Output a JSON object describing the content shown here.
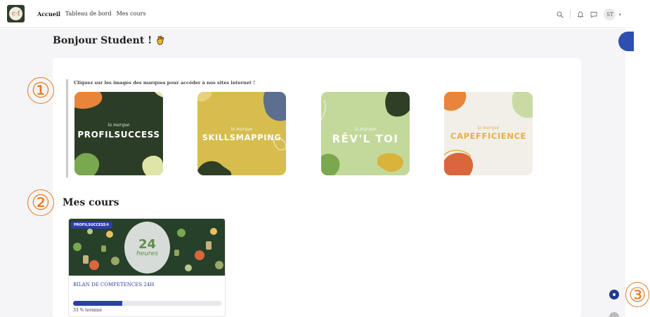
{
  "nav": {
    "logo_text": "c·f",
    "links": [
      "Accueil",
      "Tableau de bord",
      "Mes cours"
    ],
    "avatar_initials": "ST"
  },
  "greeting": "Bonjour Student !",
  "brands": {
    "intro": "Cliquez sur les images des marques pour accéder à nos sites internet !",
    "tiles": [
      {
        "small": "la marque",
        "name": "PROFILSUCCESS",
        "bg": "#2c3d27"
      },
      {
        "small": "la marque",
        "name": "SKILLSMAPPING",
        "bg": "#d6bd4e"
      },
      {
        "small": "la marque",
        "name": "RÊV'L TOI",
        "bg": "#c3d99b"
      },
      {
        "small": "la marque",
        "name": "CAPEFFICIENCE",
        "bg": "#f2efe8"
      }
    ]
  },
  "courses": {
    "title": "Mes cours",
    "items": [
      {
        "badge": "PROFILSUCCESS®",
        "hero_number": "24",
        "hero_unit": "heures",
        "name": "BILAN DE COMPETENCES 24H",
        "progress": 33,
        "progress_text": "33 % terminé"
      }
    ]
  },
  "markers": [
    "①",
    "②",
    "③"
  ],
  "colors": {
    "accent": "#2a3fa8",
    "marker": "#e8791f"
  }
}
